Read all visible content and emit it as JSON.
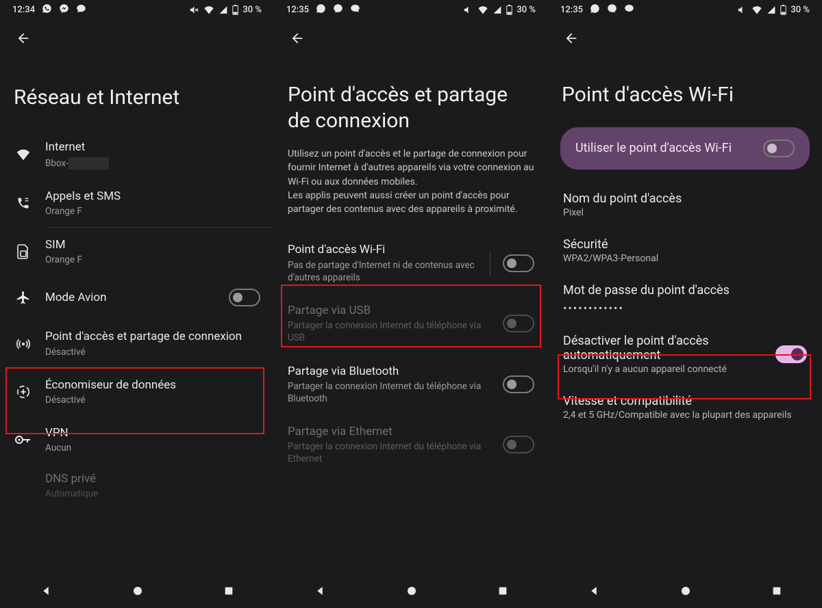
{
  "status": {
    "time1": "12:34",
    "time2": "12:35",
    "time3": "12:35",
    "battery": "30 %"
  },
  "panel1": {
    "title": "Réseau et Internet",
    "items": {
      "internet": {
        "title": "Internet",
        "sub": "Bbox-"
      },
      "calls": {
        "title": "Appels et SMS",
        "sub": "Orange F"
      },
      "sim": {
        "title": "SIM",
        "sub": "Orange F"
      },
      "airplane": {
        "title": "Mode Avion"
      },
      "hotspot": {
        "title": "Point d'accès et partage de connexion",
        "sub": "Désactivé"
      },
      "datasaver": {
        "title": "Économiseur de données",
        "sub": "Désactivé"
      },
      "vpn": {
        "title": "VPN",
        "sub": "Aucun"
      },
      "dns": {
        "title": "DNS privé",
        "sub": "Automatique"
      }
    }
  },
  "panel2": {
    "title": "Point d'accès et partage de connexion",
    "description": "Utilisez un point d'accès et le partage de connexion pour fournir Internet à d'autres appareils via votre connexion au Wi-Fi ou aux données mobiles.\nLes applis peuvent aussi créer un point d'accès pour partager des contenus avec des appareils à proximité.",
    "items": {
      "wifi": {
        "title": "Point d'accès Wi-Fi",
        "sub": "Pas de partage d'Internet ni de contenus avec d'autres appareils"
      },
      "usb": {
        "title": "Partage via USB",
        "sub": "Partager la connexion Internet du téléphone via USB"
      },
      "bt": {
        "title": "Partage via Bluetooth",
        "sub": "Partager la connexion Internet du téléphone via Bluetooth"
      },
      "eth": {
        "title": "Partage via Ethernet",
        "sub": "Partager la connexion Internet du téléphone via Ethernet"
      }
    }
  },
  "panel3": {
    "title": "Point d'accès Wi-Fi",
    "toggleLabel": "Utiliser le point d'accès Wi-Fi",
    "items": {
      "name": {
        "title": "Nom du point d'accès",
        "sub": "Pixel"
      },
      "security": {
        "title": "Sécurité",
        "sub": "WPA2/WPA3-Personal"
      },
      "password": {
        "title": "Mot de passe du point d'accès",
        "sub": "••••••••••••"
      },
      "auto": {
        "title": "Désactiver le point d'accès automatiquement",
        "sub": "Lorsqu'il n'y a aucun appareil connecté"
      },
      "speed": {
        "title": "Vitesse et compatibilité",
        "sub": "2,4 et 5 GHz/Compatible avec la plupart des appareils"
      }
    }
  }
}
